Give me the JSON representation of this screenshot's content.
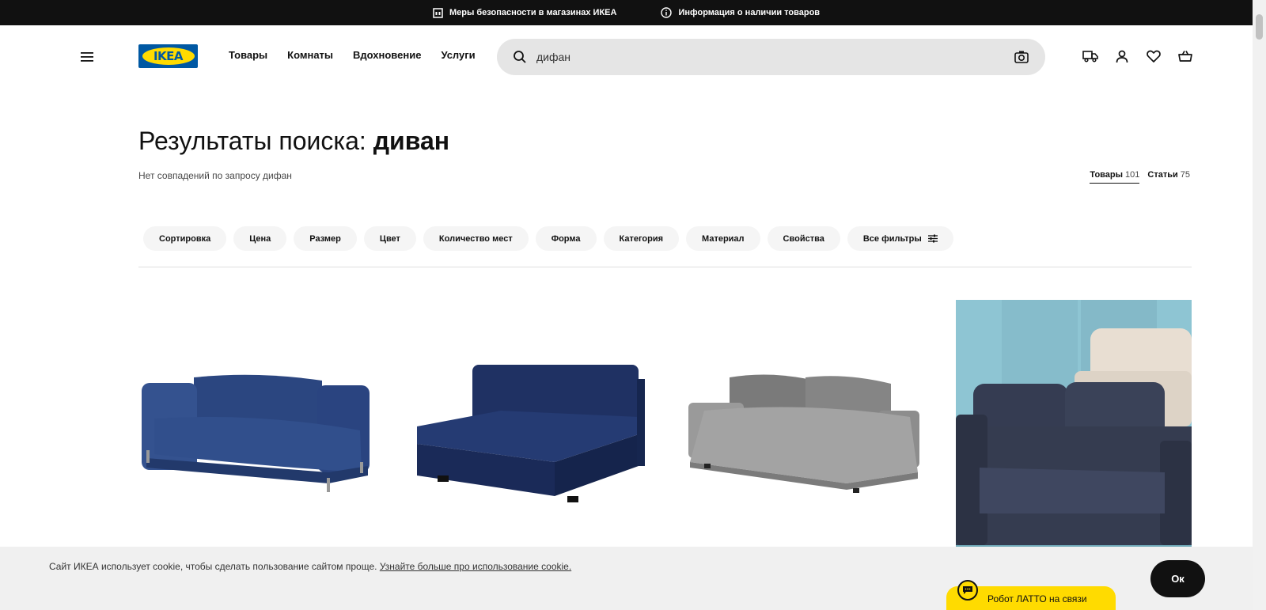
{
  "topbar": {
    "items": [
      {
        "label": "Меры безопасности в магазинах ИКЕА",
        "icon": "store-icon"
      },
      {
        "label": "Информация о наличии товаров",
        "icon": "info-icon"
      }
    ]
  },
  "header": {
    "logo_text": "IKEA",
    "nav": [
      "Товары",
      "Комнаты",
      "Вдохновение",
      "Услуги"
    ],
    "search": {
      "value": "дифан"
    },
    "icons": [
      "delivery-truck-icon",
      "user-icon",
      "heart-icon",
      "cart-icon"
    ]
  },
  "results": {
    "title_prefix": "Результаты поиска:",
    "title_query": "диван",
    "no_match": "Нет совпадений по запросу дифан",
    "tabs": [
      {
        "label": "Товары",
        "count": "101",
        "active": true
      },
      {
        "label": "Статьи",
        "count": "75",
        "active": false
      }
    ]
  },
  "filters": [
    "Сортировка",
    "Цена",
    "Размер",
    "Цвет",
    "Количество мест",
    "Форма",
    "Категория",
    "Материал",
    "Свойства",
    "Все фильтры"
  ],
  "products": [
    {
      "color": "#2e4a85"
    },
    {
      "color": "#1e2f5c"
    },
    {
      "color": "#8e8e8e"
    },
    {
      "color": "#3a4256"
    }
  ],
  "cookie": {
    "text": "Сайт ИКЕА использует cookie, чтобы сделать пользование сайтом проще.",
    "link": "Узнайте больше про использование cookie.",
    "ok_label": "Ок"
  },
  "chat": {
    "label": "Робот ЛАТТО на связи"
  },
  "colors": {
    "brand_blue": "#0058a3",
    "brand_yellow": "#ffdb00"
  }
}
